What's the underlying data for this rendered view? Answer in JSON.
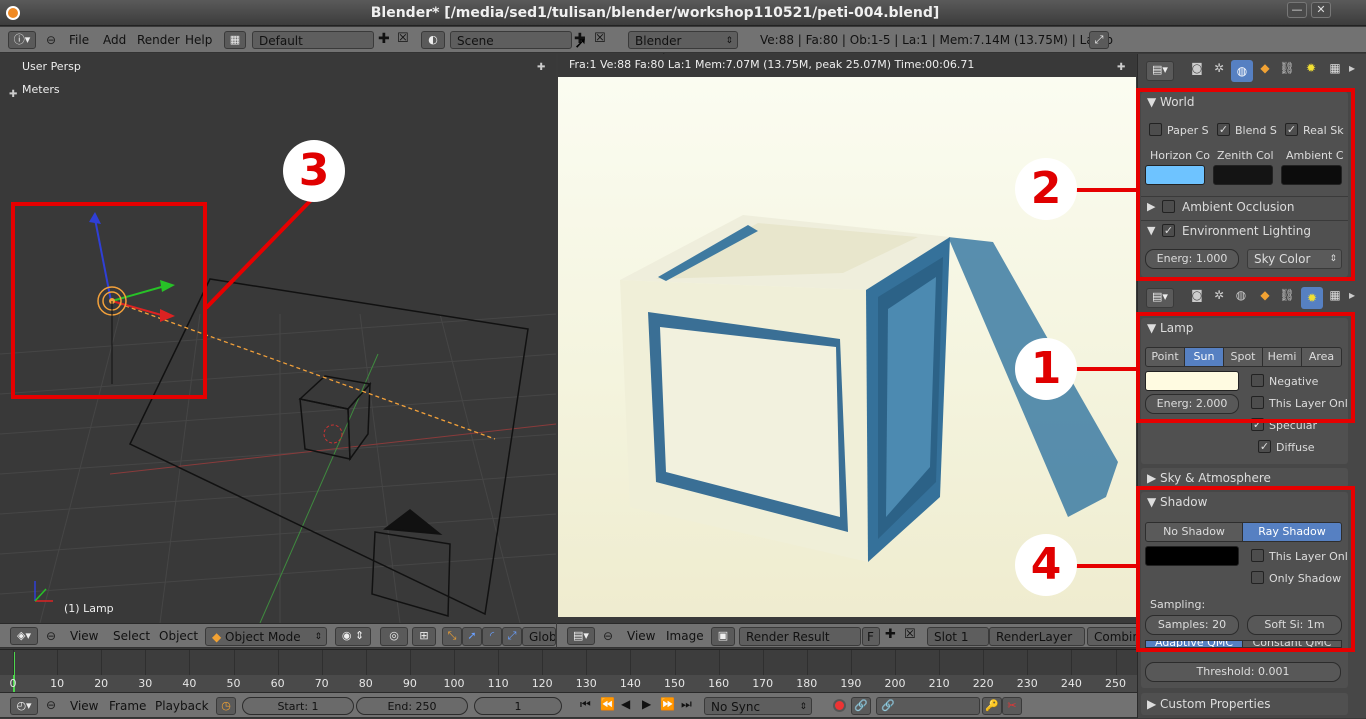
{
  "window": {
    "title": "Blender* [/media/sed1/tulisan/blender/workshop110521/peti-004.blend]",
    "min": "—",
    "close": "✕"
  },
  "infobar": {
    "menus": [
      "File",
      "Add",
      "Render",
      "Help"
    ],
    "screen": "Default",
    "scene": "Scene",
    "engine": "Blender Render",
    "stats": "Ve:88 | Fa:80 | Ob:1-5 | La:1 | Mem:7.14M (13.75M) | Lamp"
  },
  "viewport": {
    "view_name": "User Persp",
    "units": "Meters",
    "object_label": "(1) Lamp",
    "menus": [
      "View",
      "Select",
      "Object"
    ],
    "mode": "Object Mode",
    "orientation": "Globa"
  },
  "render": {
    "info": "Fra:1  Ve:88 Fa:80 La:1 Mem:7.07M (13.75M, peak 25.07M) Time:00:06.71",
    "menus": [
      "View",
      "Image"
    ],
    "image": "Render Result",
    "fake": "F",
    "slot": "Slot 1",
    "layer": "RenderLayer",
    "pass": "Combine"
  },
  "timeline": {
    "ticks": [
      "0",
      "10",
      "20",
      "30",
      "40",
      "50",
      "60",
      "70",
      "80",
      "90",
      "100",
      "110",
      "120",
      "130",
      "140",
      "150",
      "160",
      "170",
      "180",
      "190",
      "200",
      "210",
      "220",
      "230",
      "240",
      "250"
    ],
    "menus": [
      "View",
      "Frame",
      "Playback"
    ],
    "start": "Start: 1",
    "end": "End: 250",
    "current": "1",
    "sync": "No Sync"
  },
  "world_panel": {
    "title": "World",
    "checks": [
      {
        "label": "Paper S",
        "checked": false
      },
      {
        "label": "Blend S",
        "checked": true
      },
      {
        "label": "Real Sk",
        "checked": true
      }
    ],
    "colors": [
      {
        "label": "Horizon Co",
        "color": "#6ec3ff"
      },
      {
        "label": "Zenith Col",
        "color": "#141414"
      },
      {
        "label": "Ambient C",
        "color": "#0c0c0c"
      }
    ],
    "ambient_occlusion": "Ambient Occlusion",
    "env_lighting": "Environment Lighting",
    "energy": "Energ: 1.000",
    "sky_color": "Sky Color"
  },
  "lamp_panel": {
    "title": "Lamp",
    "types": [
      "Point",
      "Sun",
      "Spot",
      "Hemi",
      "Area"
    ],
    "active_type": "Sun",
    "lamp_color": "#fffbe1",
    "negative": "Negative",
    "this_layer": "This Layer Onl",
    "energy": "Energ: 2.000",
    "specular": "Specular",
    "diffuse": "Diffuse"
  },
  "sky_panel": {
    "title": "Sky & Atmosphere"
  },
  "shadow_panel": {
    "title": "Shadow",
    "no_shadow": "No Shadow",
    "ray_shadow": "Ray Shadow",
    "shadow_color": "#000000",
    "this_layer": "This Layer Onl",
    "only_shadow": "Only Shadow",
    "sampling": "Sampling:",
    "samples": "Samples: 20",
    "soft_size": "Soft Si: 1m",
    "adaptive": "Adaptive QMC",
    "constant": "Constant QMC",
    "threshold": "Threshold: 0.001"
  },
  "custom_props": "Custom Properties",
  "annotations": [
    "1",
    "2",
    "3",
    "4"
  ],
  "accent": "#5680c2",
  "annotation_color": "#e60000"
}
